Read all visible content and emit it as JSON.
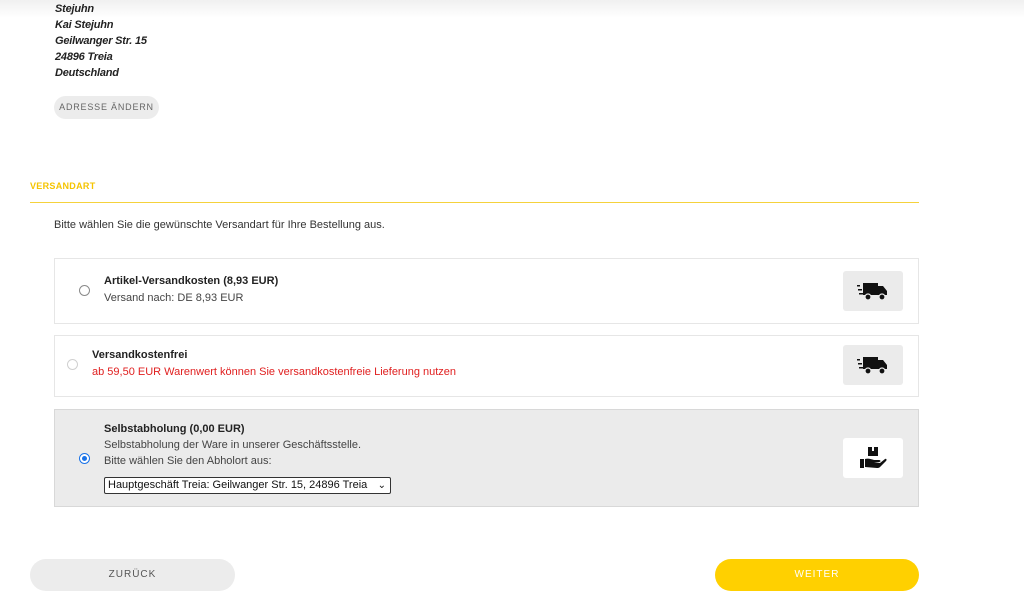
{
  "address": {
    "lines": [
      "Stejuhn",
      "Kai Stejuhn",
      "Geilwanger Str. 15",
      "24896 Treia",
      "Deutschland"
    ],
    "change_label": "ADRESSE ÄNDERN"
  },
  "shipping": {
    "section_title": "VERSANDART",
    "intro": "Bitte wählen Sie die gewünschte Versandart für Ihre Bestellung aus.",
    "options": [
      {
        "title": "Artikel-Versandkosten (8,93 EUR)",
        "subtitle": "Versand nach: DE 8,93 EUR",
        "icon": "delivery-truck-icon",
        "selected": false,
        "disabled": false
      },
      {
        "title": "Versandkostenfrei",
        "subtitle": "ab 59,50 EUR Warenwert können Sie versandkostenfreie Lieferung nutzen",
        "icon": "delivery-truck-icon",
        "selected": false,
        "disabled": true
      },
      {
        "title": "Selbstabholung (0,00 EUR)",
        "subtitle": "Selbstabholung der Ware in unserer Geschäftsstelle.",
        "subtitle2": "Bitte wählen Sie den Abholort aus:",
        "icon": "hand-package-icon",
        "selected": true,
        "disabled": false,
        "pickup_select_value": "Hauptgeschäft Treia: Geilwanger Str. 15, 24896 Treia"
      }
    ]
  },
  "nav": {
    "back_label": "ZURÜCK",
    "next_label": "WEITER"
  },
  "colors": {
    "accent": "#ffd000",
    "accent_text": "#f5c400",
    "warning": "#e02020",
    "radio_checked": "#1a73e8"
  }
}
